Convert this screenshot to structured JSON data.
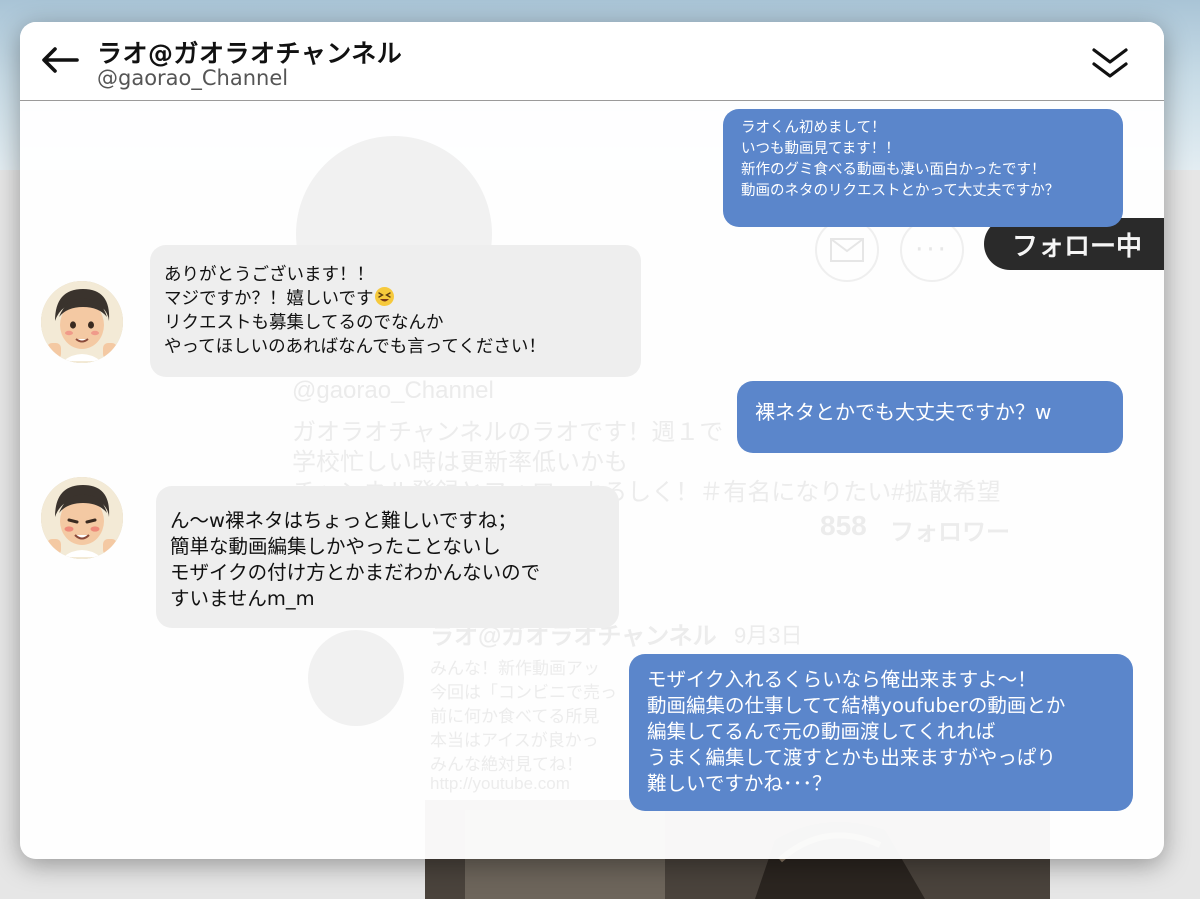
{
  "header": {
    "title": "ラオ@ガオラオチャンネル",
    "handle": "@gaorao_Channel"
  },
  "background_profile": {
    "follow_button": "フォロー中",
    "handle": "@gaorao_Channel",
    "bio_lines": [
      "ガオラオチャンネルのラオです！週１で",
      "学校忙しい時は更新率低いかも",
      "チャンネル登録とフォローよろしく！＃有名になりたい#拡散希望"
    ],
    "followers_count": "858",
    "followers_label": "フォロワー",
    "post": {
      "author": "ラオ@ガオラオチャンネル",
      "date": "9月3日",
      "lines": [
        "みんな！新作動画アッ",
        "今回は「コンビニで売っ",
        "前に何か食べてる所見",
        "本当はアイスが良かっ",
        "みんな絶対見てね！",
        "http://youtube.com"
      ]
    }
  },
  "messages": [
    {
      "from": "me",
      "lines": [
        "ラオくん初めまして！",
        "いつも動画見てます！！",
        "新作のグミ食べる動画も凄い面白かったです！",
        "動画のネタのリクエストとかって大丈夫ですか？"
      ]
    },
    {
      "from": "them",
      "lines": [
        "ありがとうございます！！",
        "マジですか？！嬉しいです",
        "リクエストも募集してるのでなんか",
        "やってほしいのあればなんでも言ってください！"
      ]
    },
    {
      "from": "me",
      "lines": [
        "裸ネタとかでも大丈夫ですか？w"
      ]
    },
    {
      "from": "them",
      "lines": [
        "ん〜w裸ネタはちょっと難しいですね；",
        "簡単な動画編集しかやったことないし",
        "モザイクの付け方とかまだわかんないので",
        "すいませんm_m"
      ]
    },
    {
      "from": "me",
      "lines": [
        "モザイク入れるくらいなら俺出来ますよ〜！",
        "動画編集の仕事してて結構youfuberの動画とか",
        "編集してるんで元の動画渡してくれれば",
        "うまく編集して渡すとかも出来ますがやっぱり",
        "難しいですかね･･･？"
      ]
    }
  ],
  "colors": {
    "sent_bubble": "#5b86cb",
    "received_bubble": "#eeeeee",
    "header_text": "#111111"
  },
  "icons": {
    "back": "arrow-left-icon",
    "collapse": "double-chevron-down-icon",
    "emoji": "grinning-squint-emoji-icon",
    "mail": "mail-icon",
    "more": "more-dots-icon"
  }
}
